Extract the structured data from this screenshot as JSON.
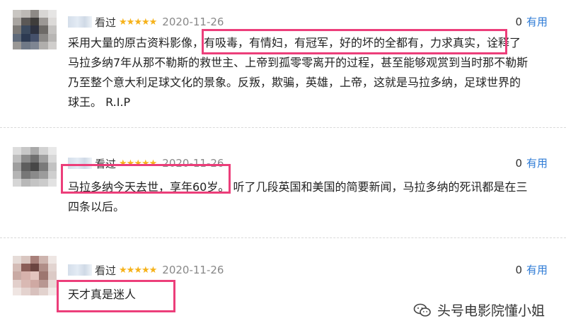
{
  "reviews": [
    {
      "watched": "看过",
      "stars": "★★★★★",
      "date": "2020-11-26",
      "useful_count": "0",
      "useful_label": "有用",
      "lines": [
        "采用大量的原古资料影像，有吸毒，有情妇，有冠军，好的坏的全都有，力求真实，诠释了",
        "马拉多纳7年从那不勒斯的救世主、上帝到孤零零离开的过程，甚至能够观赏到当时那不勒斯",
        "乃至整个意大利足球文化的景象。反叛，欺骗，英雄，上帝，这就是马拉多纳，足球世界的",
        "球王。 R.I.P"
      ]
    },
    {
      "watched": "看过",
      "stars": "★★★★★",
      "date": "2020-11-26",
      "useful_count": "0",
      "useful_label": "有用",
      "lines": [
        "马拉多纳今天去世，享年60岁。 听了几段英国和美国的简要新闻，马拉多纳的死讯都是在三",
        "四条以后。"
      ]
    },
    {
      "watched": "看过",
      "stars": "★★★★★",
      "date": "2020-11-26",
      "useful_count": "0",
      "useful_label": "有用",
      "lines": [
        "天才真是迷人"
      ]
    }
  ],
  "watermark": {
    "text": "头号电影院懂小姐",
    "icon": "wechat-icon"
  },
  "colors": {
    "highlight": "#ec3e7a",
    "stars": "#f6b21a",
    "useful": "#2e7bd6"
  }
}
